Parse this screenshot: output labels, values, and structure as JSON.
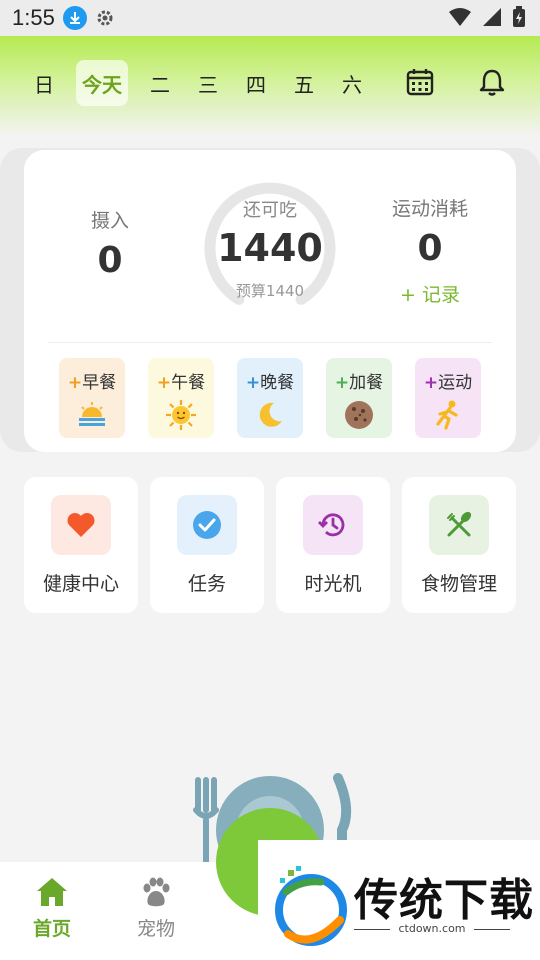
{
  "status_bar": {
    "time": "1:55"
  },
  "header": {
    "days": [
      {
        "label": "日",
        "active": false
      },
      {
        "label": "今天",
        "active": true
      },
      {
        "label": "二",
        "active": false
      },
      {
        "label": "三",
        "active": false
      },
      {
        "label": "四",
        "active": false
      },
      {
        "label": "五",
        "active": false
      },
      {
        "label": "六",
        "active": false
      }
    ]
  },
  "summary": {
    "intake_label": "摄入",
    "intake_value": "0",
    "remaining_label": "还可吃",
    "remaining_value": "1440",
    "budget_text": "预算1440",
    "exercise_label": "运动消耗",
    "exercise_value": "0",
    "record_link": "+ 记录",
    "gauge_progress": 0
  },
  "meals": [
    {
      "label": "早餐",
      "plus": "+",
      "bg": "#fdeedb",
      "plus_color": "#f0a020",
      "icon": "sunrise-icon"
    },
    {
      "label": "午餐",
      "plus": "+",
      "bg": "#fdf9de",
      "plus_color": "#f0a020",
      "icon": "sun-icon"
    },
    {
      "label": "晚餐",
      "plus": "+",
      "bg": "#e2f0fc",
      "plus_color": "#3a8fd8",
      "icon": "moon-icon"
    },
    {
      "label": "加餐",
      "plus": "+",
      "bg": "#e6f4e4",
      "plus_color": "#4caf50",
      "icon": "cookie-icon"
    },
    {
      "label": "运动",
      "plus": "+",
      "bg": "#f6e4f6",
      "plus_color": "#a030b0",
      "icon": "runner-icon"
    }
  ],
  "tiles": [
    {
      "label": "健康中心",
      "icon": "heart-icon",
      "bg": "#fde8e2"
    },
    {
      "label": "任务",
      "icon": "check-circle-icon",
      "bg": "#e4f1fd"
    },
    {
      "label": "时光机",
      "icon": "history-icon",
      "bg": "#f4e4f6"
    },
    {
      "label": "食物管理",
      "icon": "utensils-icon",
      "bg": "#e8f2e2"
    }
  ],
  "bottom_nav": {
    "items": [
      {
        "label": "首页",
        "icon": "home-icon",
        "active": true
      },
      {
        "label": "宠物",
        "icon": "paw-icon",
        "active": false
      }
    ]
  },
  "watermark": {
    "text": "传统下载",
    "url": "ctdown.com"
  },
  "colors": {
    "accent": "#7cb82f",
    "header_top": "#b5ea51"
  }
}
